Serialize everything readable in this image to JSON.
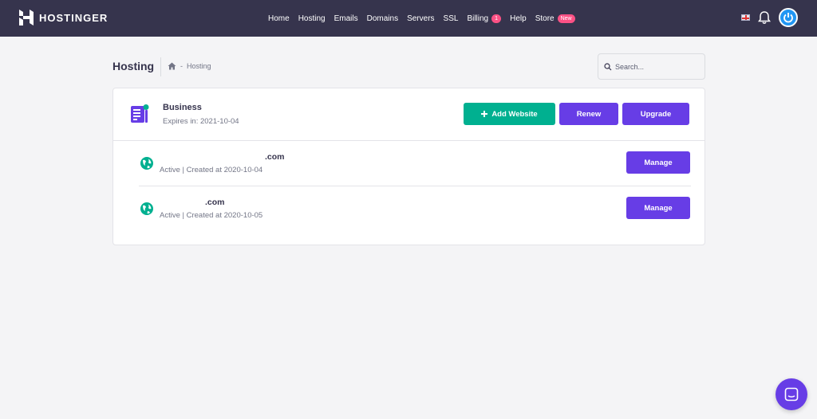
{
  "brand": {
    "name": "HOSTINGER"
  },
  "nav": {
    "items": [
      {
        "label": "Home"
      },
      {
        "label": "Hosting"
      },
      {
        "label": "Emails"
      },
      {
        "label": "Domains"
      },
      {
        "label": "Servers"
      },
      {
        "label": "SSL"
      },
      {
        "label": "Billing",
        "badge": "1"
      },
      {
        "label": "Help"
      },
      {
        "label": "Store",
        "badge": "New"
      }
    ]
  },
  "page": {
    "title": "Hosting",
    "breadcrumb": {
      "home_icon": "home-icon",
      "separator": "-",
      "current": "Hosting"
    }
  },
  "search": {
    "placeholder": "Search..."
  },
  "plan": {
    "name": "Business",
    "expires": "Expires in: 2021-10-04",
    "buttons": {
      "add_website": "Add Website",
      "renew": "Renew",
      "upgrade": "Upgrade"
    }
  },
  "sites": [
    {
      "domain": ".com",
      "status": "Active | Created at 2020-10-04",
      "manage": "Manage"
    },
    {
      "domain": ".com",
      "status": "Active | Created at 2020-10-05",
      "manage": "Manage"
    }
  ],
  "colors": {
    "nav_bg": "#36344d",
    "green": "#00b090",
    "purple": "#673de6",
    "badge": "#fc5185",
    "globe": "#00b090"
  }
}
